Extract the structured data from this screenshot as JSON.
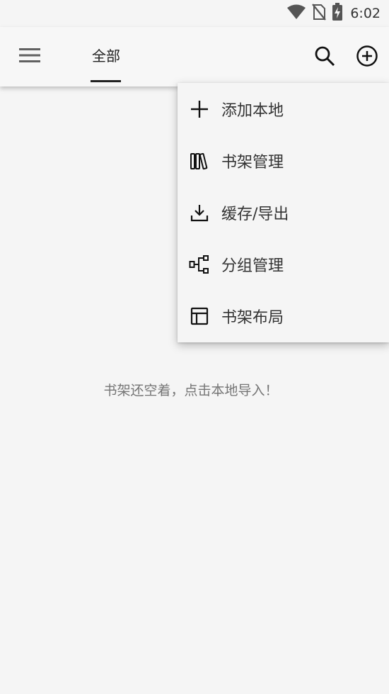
{
  "status_bar": {
    "time": "6:02",
    "icons": [
      "wifi-icon",
      "no-sim-icon",
      "battery-charging-icon"
    ]
  },
  "app_bar": {
    "menu_icon": "hamburger-menu-icon",
    "tabs": [
      {
        "label": "全部",
        "selected": true
      }
    ],
    "search_icon": "search-icon",
    "add_icon": "add-circle-icon"
  },
  "main": {
    "empty_message": "书架还空着，点击本地导入！"
  },
  "popup_menu": {
    "items": [
      {
        "label": "添加本地",
        "icon": "plus-icon"
      },
      {
        "label": "书架管理",
        "icon": "bookshelf-icon"
      },
      {
        "label": "缓存/导出",
        "icon": "download-icon"
      },
      {
        "label": "分组管理",
        "icon": "group-icon"
      },
      {
        "label": "书架布局",
        "icon": "layout-icon"
      }
    ]
  }
}
